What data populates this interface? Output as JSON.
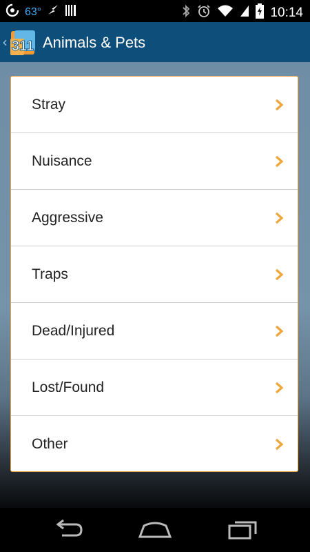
{
  "status_bar": {
    "temperature": "63°",
    "time": "10:14"
  },
  "header": {
    "title": "Animals & Pets",
    "logo_text": "311"
  },
  "menu": {
    "items": [
      {
        "label": "Stray"
      },
      {
        "label": "Nuisance"
      },
      {
        "label": "Aggressive"
      },
      {
        "label": "Traps"
      },
      {
        "label": "Dead/Injured"
      },
      {
        "label": "Lost/Found"
      },
      {
        "label": "Other"
      }
    ]
  },
  "colors": {
    "action_bar": "#0d4e7a",
    "accent_orange": "#f0a53a",
    "temp_blue": "#3fa9f5"
  }
}
